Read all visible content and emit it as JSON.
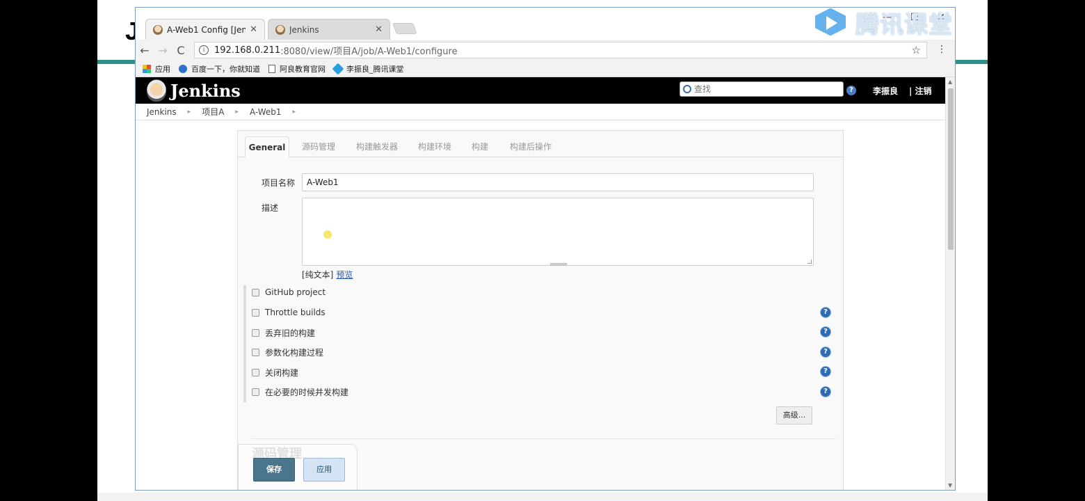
{
  "slide": {
    "letter": "J"
  },
  "watermark": {
    "text": "腾讯课堂"
  },
  "browser": {
    "tabs": [
      {
        "title": "A-Web1 Config [Jenkins]",
        "close": "✕"
      },
      {
        "title": "Jenkins",
        "close": "✕"
      }
    ],
    "window_controls": {
      "minimize": "—",
      "maximize": "☐",
      "close": "✕"
    },
    "nav": {
      "back": "←",
      "forward": "→",
      "reload": "C"
    },
    "address": {
      "host": "192.168.0.211",
      "path": ":8080/view/项目A/job/A-Web1/configure"
    },
    "bookmarks": [
      "应用",
      "百度一下，你就知道",
      "阿良教育官网",
      "李振良_腾讯课堂"
    ]
  },
  "jenkins": {
    "title": "Jenkins",
    "search_placeholder": "查找",
    "help": "?",
    "user": "李振良",
    "logout": "| 注销",
    "breadcrumbs": [
      "Jenkins",
      "项目A",
      "A-Web1"
    ],
    "tabs": [
      {
        "label": "General"
      },
      {
        "label": "源码管理"
      },
      {
        "label": "构建触发器"
      },
      {
        "label": "构建环境"
      },
      {
        "label": "构建"
      },
      {
        "label": "构建后操作"
      }
    ],
    "form": {
      "name_label": "项目名称",
      "name_value": "A-Web1",
      "desc_label": "描述",
      "markup_note": "[纯文本]",
      "preview": "预览"
    },
    "options": [
      {
        "label": "GitHub project",
        "help": false
      },
      {
        "label": "Throttle builds",
        "help": true
      },
      {
        "label": "丢弃旧的构建",
        "help": true
      },
      {
        "label": "参数化构建过程",
        "help": true
      },
      {
        "label": "关闭构建",
        "help": true
      },
      {
        "label": "在必要的时候并发构建",
        "help": true
      }
    ],
    "advanced": "高级...",
    "next_section": "源码管理",
    "save": "保存",
    "apply": "应用"
  }
}
